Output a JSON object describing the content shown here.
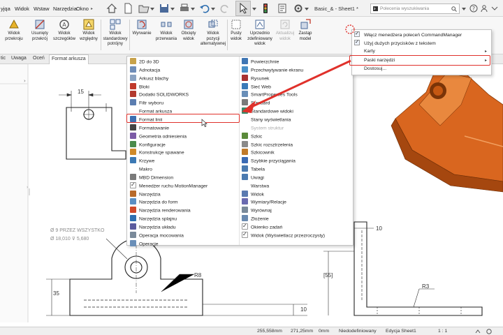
{
  "menubar": {
    "items": [
      "yjqa",
      "Widok",
      "Wstaw",
      "Narzędzia",
      "Okno"
    ],
    "document_title": "Basic_& - Sheet1 *",
    "search_placeholder": "Polecenia wyszukiwania"
  },
  "ribbon": {
    "buttons": [
      {
        "label": "Widok\nprzekroju",
        "disabled": false
      },
      {
        "label": "Usunięty\nprzekrój",
        "disabled": false
      },
      {
        "label": "Widok\nszczegółów",
        "disabled": false
      },
      {
        "label": "Widok\nwzględny",
        "disabled": false
      },
      {
        "label": "Widok\nstandardowy\npotrójny",
        "disabled": false
      },
      {
        "label": "Wyrwanie",
        "disabled": false
      },
      {
        "label": "Widok\nprzerwania",
        "disabled": false
      },
      {
        "label": "Obcięty\nwidok",
        "disabled": false
      },
      {
        "label": "Widok\npozycji\nalternatywnej",
        "disabled": false
      },
      {
        "label": "Pusty\nwidok",
        "disabled": false
      },
      {
        "label": "Uprzednio\nzdefiniowany\nwidok",
        "disabled": false
      },
      {
        "label": "Aktualizuj\nwidok",
        "disabled": true
      },
      {
        "label": "Zastąp\nmodel",
        "disabled": false
      }
    ]
  },
  "tabs": [
    {
      "label": "tic",
      "active": false
    },
    {
      "label": "Uwaga",
      "active": false
    },
    {
      "label": "Oceń",
      "active": false
    },
    {
      "label": "Format arkusza",
      "active": true
    }
  ],
  "toolbar_menu": {
    "left": [
      {
        "label": "2D do 3D",
        "color": "#c8a24a",
        "style": "icon"
      },
      {
        "label": "Adnotacja",
        "color": "#6f8db8",
        "style": "icon"
      },
      {
        "label": "Arkusz blachy",
        "color": "#8aa2c2",
        "style": "icon"
      },
      {
        "label": "Bloki",
        "color": "#c0392b",
        "style": "icon"
      },
      {
        "label": "Dodatki SOLIDWORKS",
        "color": "#b33a2f",
        "style": "icon"
      },
      {
        "label": "Filtr wyboru",
        "color": "#5b7db0",
        "style": "icon"
      },
      {
        "label": "Format arkusza",
        "color": "#ffffff",
        "style": "blank"
      },
      {
        "label": "Format linii",
        "color": "#3e6fb0",
        "style": "icon"
      },
      {
        "label": "Formatowanie",
        "color": "#444444",
        "style": "icon"
      },
      {
        "label": "Geometria odniesienia",
        "color": "#7b5aa6",
        "style": "icon"
      },
      {
        "label": "Konfiguracje",
        "color": "#4a8a4a",
        "style": "icon"
      },
      {
        "label": "Konstrukcje spawane",
        "color": "#d08a2a",
        "style": "icon"
      },
      {
        "label": "Krzywe",
        "color": "#3c79b4",
        "style": "icon"
      },
      {
        "label": "Makro",
        "color": "#e0e0e0",
        "style": "blank"
      },
      {
        "label": "MBD Dimension",
        "color": "#7a7a7a",
        "style": "icon"
      },
      {
        "label": "Menedżer ruchu MotionManager",
        "color": "#ffffff",
        "style": "check"
      },
      {
        "label": "Narzędzia",
        "color": "#b86a2a",
        "style": "icon"
      },
      {
        "label": "Narzędzia do form",
        "color": "#5a8fc4",
        "style": "icon"
      },
      {
        "label": "Narzędzia renderowania",
        "color": "#d04a2a",
        "style": "icon"
      },
      {
        "label": "Narzędzia splajnu",
        "color": "#2f6fb0",
        "style": "icon"
      },
      {
        "label": "Narzędzia układu",
        "color": "#5b5b9e",
        "style": "icon"
      },
      {
        "label": "Operacja mocowania",
        "color": "#7a8a9a",
        "style": "icon"
      },
      {
        "label": "Operacje",
        "color": "#6a8fb8",
        "style": "icon"
      }
    ],
    "right": [
      {
        "label": "Powierzchnie",
        "color": "#3f76b4",
        "style": "icon",
        "disabled": false
      },
      {
        "label": "Przechwytywanie ekranu",
        "color": "#4a90c8",
        "style": "icon",
        "disabled": false
      },
      {
        "label": "Rysunek",
        "color": "#a83232",
        "style": "icon",
        "disabled": false
      },
      {
        "label": "Sieć Web",
        "color": "#3a7ab8",
        "style": "icon",
        "disabled": false
      },
      {
        "label": "SmartProperties Tools",
        "color": "#6a8fb8",
        "style": "icon",
        "disabled": false
      },
      {
        "label": "Standard",
        "color": "#7a7a7a",
        "style": "icon",
        "disabled": false
      },
      {
        "label": "Standardowe widoki",
        "color": "#3a8a6a",
        "style": "icon",
        "disabled": false
      },
      {
        "label": "Stany wyświetlania",
        "color": "#ffffff",
        "style": "blank",
        "disabled": false
      },
      {
        "label": "System struktur",
        "color": "#ffffff",
        "style": "blank",
        "disabled": true
      },
      {
        "label": "Szkic",
        "color": "#5a8a3a",
        "style": "icon",
        "disabled": false
      },
      {
        "label": "Szkic rozsztrzelenia",
        "color": "#8a8a8a",
        "style": "icon",
        "disabled": false
      },
      {
        "label": "Szkicownik",
        "color": "#c07a2a",
        "style": "icon",
        "disabled": false
      },
      {
        "label": "Szybkie przyciągania",
        "color": "#3a6ab4",
        "style": "icon",
        "disabled": false
      },
      {
        "label": "Tabela",
        "color": "#4a7ab0",
        "style": "icon",
        "disabled": false
      },
      {
        "label": "Uwagi",
        "color": "#4a7ab0",
        "style": "icon",
        "disabled": false
      },
      {
        "label": "Warstwa",
        "color": "#ffffff",
        "style": "blank",
        "disabled": false
      },
      {
        "label": "Widok",
        "color": "#5a7ab0",
        "style": "icon",
        "disabled": false
      },
      {
        "label": "Wymiary/Relacje",
        "color": "#6a6ab0",
        "style": "icon",
        "disabled": false
      },
      {
        "label": "Wyrównaj",
        "color": "#7a8a9a",
        "style": "icon",
        "disabled": false
      },
      {
        "label": "Złożenie",
        "color": "#6a8ab0",
        "style": "icon",
        "disabled": false
      },
      {
        "label": "Okienko zadań",
        "color": "#ffffff",
        "style": "check",
        "disabled": false
      },
      {
        "label": "Widok (Wyświetlacz przezroczysty)",
        "color": "#ffffff",
        "style": "check",
        "disabled": false
      }
    ]
  },
  "context_menu": {
    "items": [
      {
        "label": "Włącz menedżera poleceń CommandManager",
        "checked": true,
        "submenu": false
      },
      {
        "label": "Użyj dużych przycisków z tekstem",
        "checked": true,
        "submenu": false
      },
      {
        "label": "Karty",
        "checked": false,
        "submenu": true
      },
      {
        "label": "Paski narzędzi",
        "checked": false,
        "submenu": true
      },
      {
        "label": "Dostosuj...",
        "checked": false,
        "submenu": false
      }
    ]
  },
  "drawing": {
    "dim_15": "15",
    "dim_10_right": "10",
    "dim_10_bottom": "10",
    "dim_35": "35",
    "dim_55": "[55]",
    "r8": "R8",
    "r3": "R3",
    "hole_note_1": "Ø 9 PRZEZ WSZYSTKO",
    "hole_note_2": "Ø 18,010 ⊽ 5,680"
  },
  "statusbar": {
    "x": "255,558mm",
    "y": "271,25mm",
    "z": "0mm",
    "state": "Niedodefiniowany",
    "mode": "Edycja Sheet1",
    "scale": "1 : 1"
  },
  "colors": {
    "accent_red": "#e0312b",
    "part_orange": "#d9661f"
  }
}
